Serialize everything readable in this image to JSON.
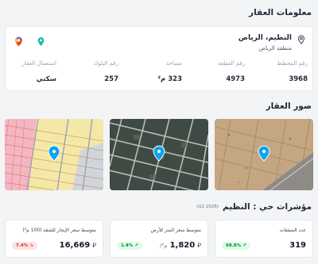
{
  "property_info": {
    "title": "معلومات العقار",
    "location_name": "النظيم، الرياض",
    "region": "منطقة الرياض",
    "fields": [
      {
        "label": "رقم المخطط",
        "value": "3968"
      },
      {
        "label": "رقم القطعة",
        "value": "4973"
      },
      {
        "label": "مساحة",
        "value": "323 م²"
      },
      {
        "label": "رقم البلوك",
        "value": "257"
      },
      {
        "label": "استعمال العقار",
        "value": "سكني"
      }
    ]
  },
  "photos": {
    "title": "صور العقار"
  },
  "indicators": {
    "title": "مؤشرات حي : النظيم",
    "period_badge": "(Q2 2026)",
    "metrics": [
      {
        "label": "عدد الصفقات",
        "value": "319",
        "change": "68.8%",
        "trend": "up",
        "change_color": "#15803d"
      },
      {
        "label": "متوسط سعر المتر للأرض",
        "value": "1,820",
        "unit": "م²/",
        "change": "1.4%",
        "trend": "up",
        "change_color": "#15803d"
      },
      {
        "label": "متوسط سعر الإيجار للشقة (100 م²)",
        "value": "16,669",
        "change": "7.4%",
        "trend": "down",
        "change_color": "#dc2626"
      }
    ]
  },
  "colors": {
    "accent": "#14b8a6",
    "google_maps_pin": "#ea4335",
    "map_pin": "#0ea5e9"
  }
}
